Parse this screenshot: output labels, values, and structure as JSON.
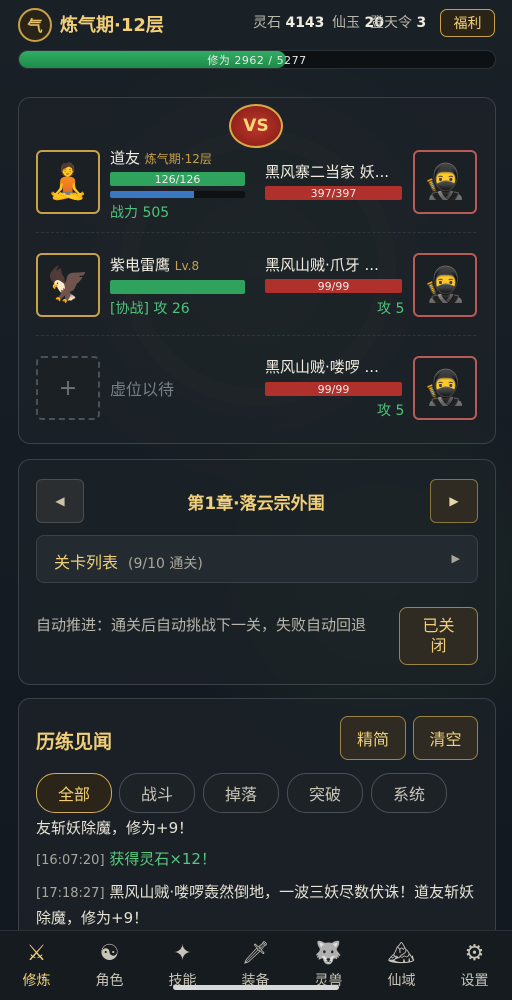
{
  "header": {
    "realm_badge": "气",
    "realm_title": "炼气期·12层",
    "resources": [
      {
        "label": "灵石",
        "value": "4143"
      },
      {
        "label": "仙玉",
        "value": "20"
      },
      {
        "label": "登天令",
        "value": "3"
      }
    ],
    "welfare_label": "福利",
    "cultivation": {
      "text": "修为 2962 / 5277",
      "progress": 0.561
    }
  },
  "battle": {
    "vs_label": "VS",
    "allies": [
      {
        "name": "道友",
        "realm": "炼气期·12层",
        "hp_text": "126/126",
        "hp": 1.0,
        "mp": 0.62,
        "stat": "战力 505",
        "avatar_icon": "meditating-person-icon"
      },
      {
        "name": "紫电雷鹰",
        "level": "Lv.8",
        "hp": 1.0,
        "stat": "[协战] 攻 26",
        "avatar_icon": "eagle-icon"
      },
      {
        "empty_label": "虚位以待",
        "plus": "+"
      }
    ],
    "enemies": [
      {
        "name": "黑风寨二当家 妖...",
        "hp_text": "397/397",
        "hp": 1.0,
        "avatar_icon": "ninja-icon"
      },
      {
        "name": "黑风山贼·爪牙 ...",
        "hp_text": "99/99",
        "hp": 1.0,
        "stat": "攻 5",
        "avatar_icon": "ninja-icon"
      },
      {
        "name": "黑风山贼·喽啰 ...",
        "hp_text": "99/99",
        "hp": 1.0,
        "stat": "攻 5",
        "avatar_icon": "ninja-icon"
      }
    ]
  },
  "chapter": {
    "prev_icon": "◀",
    "next_icon": "▶",
    "title": "第1章·落云宗外围",
    "stage_list_label": "关卡列表",
    "stage_progress": "(9/10 通关)",
    "stage_arrow": "▶",
    "auto_text": "自动推进：通关后自动挑战下一关，失败自动回退",
    "auto_button": "已关闭"
  },
  "log": {
    "title": "历练见闻",
    "btn_simple": "精简",
    "btn_clear": "清空",
    "filters": [
      "全部",
      "战斗",
      "掉落",
      "突破",
      "系统"
    ],
    "lines": [
      {
        "ts": "",
        "text": "友斩妖除魔，修为+9！"
      },
      {
        "ts": "[16:07:20]",
        "text": "获得灵石×12！"
      },
      {
        "ts": "[17:18:27]",
        "text": "黑风山贼·喽啰轰然倒地，一波三妖尽数伏诛！道友斩妖除魔，修为+9！"
      }
    ]
  },
  "nav": [
    {
      "label": "修炼",
      "icon": "crossed-swords-icon"
    },
    {
      "label": "角色",
      "icon": "yin-yang-icon"
    },
    {
      "label": "技能",
      "icon": "sparkle-icon"
    },
    {
      "label": "装备",
      "icon": "sword-icon"
    },
    {
      "label": "灵兽",
      "icon": "wolf-icon"
    },
    {
      "label": "仙域",
      "icon": "mountain-icon"
    },
    {
      "label": "设置",
      "icon": "gear-icon"
    }
  ],
  "colors": {
    "gold": "#f1cf78",
    "green": "#2fa25e",
    "red": "#b0302b",
    "bg": "#141a20"
  }
}
